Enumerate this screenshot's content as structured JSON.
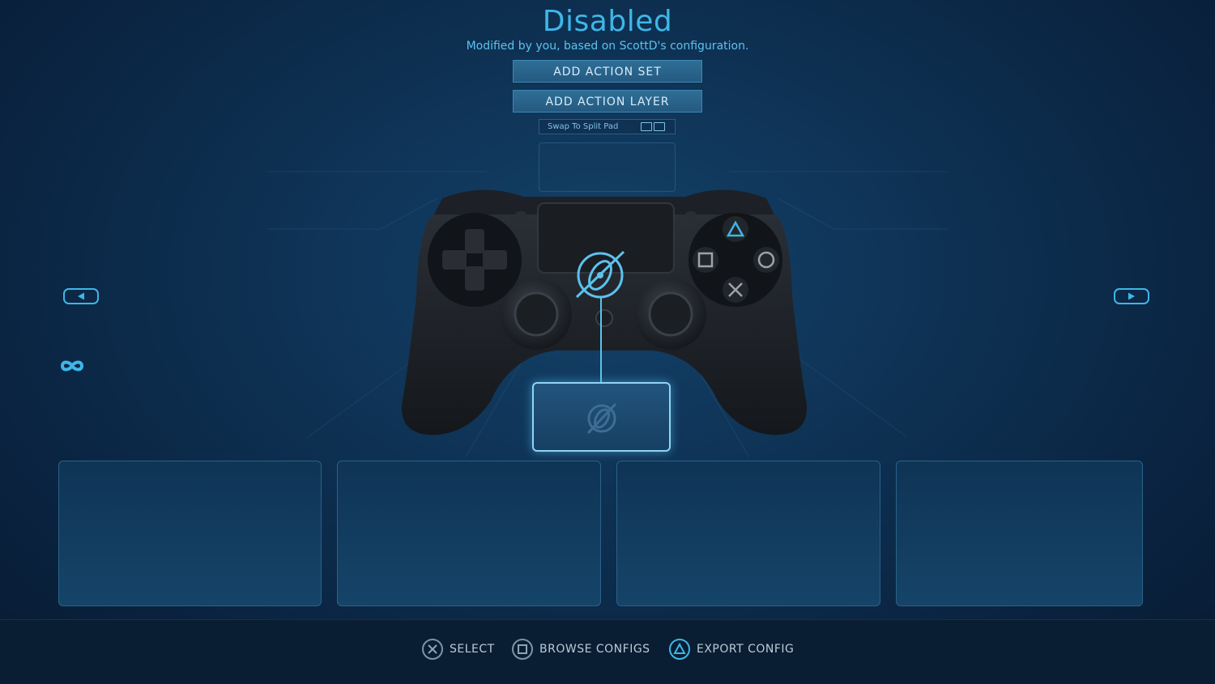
{
  "header": {
    "title": "Disabled",
    "subtitle": "Modified by you, based on ScottD's configuration."
  },
  "buttons": {
    "add_action_set": "ADD ACTION SET",
    "add_action_layer": "ADD ACTION LAYER",
    "swap_to_split_pad": "Swap To Split Pad"
  },
  "footer": {
    "select": "SELECT",
    "browse_configs": "BROWSE CONFIGS",
    "export_config": "EXPORT CONFIG"
  },
  "colors": {
    "accent": "#3fb6e8",
    "background": "#0d2f50",
    "button": "#2f6e96"
  },
  "icons": {
    "left_arrow": "arrow-left-icon",
    "right_arrow": "arrow-right-icon",
    "infinity": "infinity-icon",
    "gyro": "gyro-icon",
    "cross": "cross-button-icon",
    "square": "square-button-icon",
    "triangle": "triangle-button-icon"
  }
}
